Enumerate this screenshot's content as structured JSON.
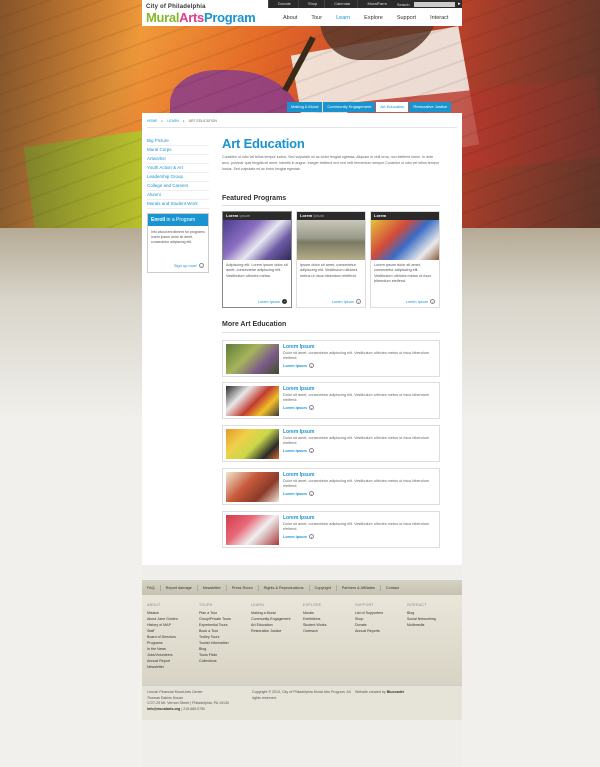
{
  "header": {
    "city": "City of Philadelphia",
    "logo_part1": "Mural",
    "logo_part2": "Arts",
    "logo_part3": "Program",
    "util_links": [
      "Donate",
      "Shop",
      "Calendar",
      "MuralFarm"
    ],
    "search_label": "Search",
    "main_nav": [
      "About",
      "Tour",
      "Learn",
      "Explore",
      "Support",
      "Interact"
    ],
    "active_nav": "Learn"
  },
  "subnav": [
    "Making A Mural",
    "Community Engagement",
    "Art Education",
    "Restorative Justice"
  ],
  "breadcrumb": [
    "HOME",
    "LEARN",
    "ART EDUCATION"
  ],
  "sidebar": {
    "items": [
      "Big Picture",
      "Mural Corps",
      "Artworks!",
      "Youth Action & Art",
      "Leadership Group",
      "College and Careers",
      "Alumni",
      "Murals and Student Work"
    ],
    "enroll_title_bold": "Enroll",
    "enroll_title_rest": " in a Program",
    "enroll_text": "Info about enrollment for programs lorem ipsum dolor sit amet, consectetur adipiscing elit.",
    "signup_label": "Sign up now!"
  },
  "main": {
    "title": "Art Education",
    "intro": "Curabitur ut odio vel tellus tempor luctus. Sed vulputate mi ac tortor feugiat egestas. Aliquam id velit urna, non eleifend lorem. In ante arcu, pulvinar quis fringilla sit amet, lobortis in augue. Integer eleifend orci sed velit fermentum semper.Curabitur ut odio vel tellus tempor luctus. Sed vulputate mi ac tortor feugiat egestas.",
    "featured_heading": "Featured Programs",
    "featured": [
      {
        "title_bold": "Lorem",
        "title_rest": " Ipsum",
        "text": "Adipiscing elit. Lorem ipsum dolor sit amet, consectetur adipiscing elit. Vestibulum ultricies metus.",
        "more": "Lorem Ipsum"
      },
      {
        "title_bold": "Lorem",
        "title_rest": " Ipsum",
        "text": "Ipsum dolor sit amet, consectetur adipiscing elit. Vestibulum ultricies metus ut risus bibendum eleifend.",
        "more": "Lorem Ipsum"
      },
      {
        "title_bold": "Lorem",
        "title_rest": "",
        "text": "Lorem ipsum dolor sit amet, consectetur adipiscing elit. Vestibulum ultricies metus ut risus bibendum eleifend.",
        "more": "Lorem Ipsum"
      }
    ],
    "more_heading": "More Art Education",
    "more_items": [
      {
        "title": "Lorem Ipsum",
        "desc": "Dolor sit amet, consectetur adipiscing elit. Vestibulum ultricies metus ut risus bibendum eleifend.",
        "link": "Lorem Ipsum"
      },
      {
        "title": "Lorem Ipsum",
        "desc": "Dolor sit amet, consectetur adipiscing elit. Vestibulum ultricies metus ut risus bibendum eleifend.",
        "link": "Lorem Ipsum"
      },
      {
        "title": "Lorem Ipsum",
        "desc": "Dolor sit amet, consectetur adipiscing elit. Vestibulum ultricies metus ut risus bibendum eleifend.",
        "link": "Lorem Ipsum"
      },
      {
        "title": "Lorem Ipsum",
        "desc": "Dolor sit amet, consectetur adipiscing elit. Vestibulum ultricies metus ut risus bibendum eleifend.",
        "link": "Lorem Ipsum"
      },
      {
        "title": "Lorem Ipsum",
        "desc": "Dolor sit amet, consectetur adipiscing elit. Vestibulum ultricies metus ut risus bibendum eleifend.",
        "link": "Lorem Ipsum"
      }
    ]
  },
  "footer": {
    "bar_links": [
      "FAQ",
      "Report damage",
      "Newsletter",
      "Press Room",
      "Rights & Reproductions",
      "Copyright",
      "Partners & Affiliates",
      "Contact"
    ],
    "columns": [
      {
        "heading": "ABOUT",
        "items": [
          "Mission",
          "About Jane Golden",
          "History of MAP",
          "Staff",
          "Board of Directors",
          "Programs",
          "In the News",
          "Jobs/Volunteers",
          "Annual Report",
          "Newsletter"
        ]
      },
      {
        "heading": "TOURS",
        "items": [
          "Plan a Tour",
          "Group/Private Tours",
          "Experiential Tours",
          "Book a Tour",
          "Trolley Tours",
          "Tourist Information",
          "Blog",
          "Tours Flickr",
          "Collections"
        ]
      },
      {
        "heading": "LEARN",
        "items": [
          "Making a Mural",
          "Community Engagement",
          "Art Education",
          "Restorative Justice"
        ]
      },
      {
        "heading": "EXPLORE",
        "items": [
          "Murals",
          "Exhibitions",
          "Student Works",
          "Outreach"
        ]
      },
      {
        "heading": "SUPPORT",
        "items": [
          "List of Supporters",
          "Shop",
          "Donate",
          "Annual Reports"
        ]
      },
      {
        "heading": "INTERACT",
        "items": [
          "Blog",
          "Social Networking",
          "Multimedia"
        ]
      }
    ],
    "address_lines": [
      "Lincoln Financial Mural Arts Center",
      "Thomas Eakins House",
      "1727-29 Mt. Vernon Street | Philadelphia, PA 19130"
    ],
    "email": "info@muralarts.org",
    "phone": "| 215.685.0750",
    "copyright": "Copyright © 2010, City of Philadelphia Mural Arts Program. All rights reserved.",
    "credit_prefix": "Website created by",
    "credit_name": "Bluecadet"
  },
  "colors": {
    "accent": "#1a94cf",
    "dark": "#2b2b2b",
    "footer_bg": "#d8d3c4"
  }
}
